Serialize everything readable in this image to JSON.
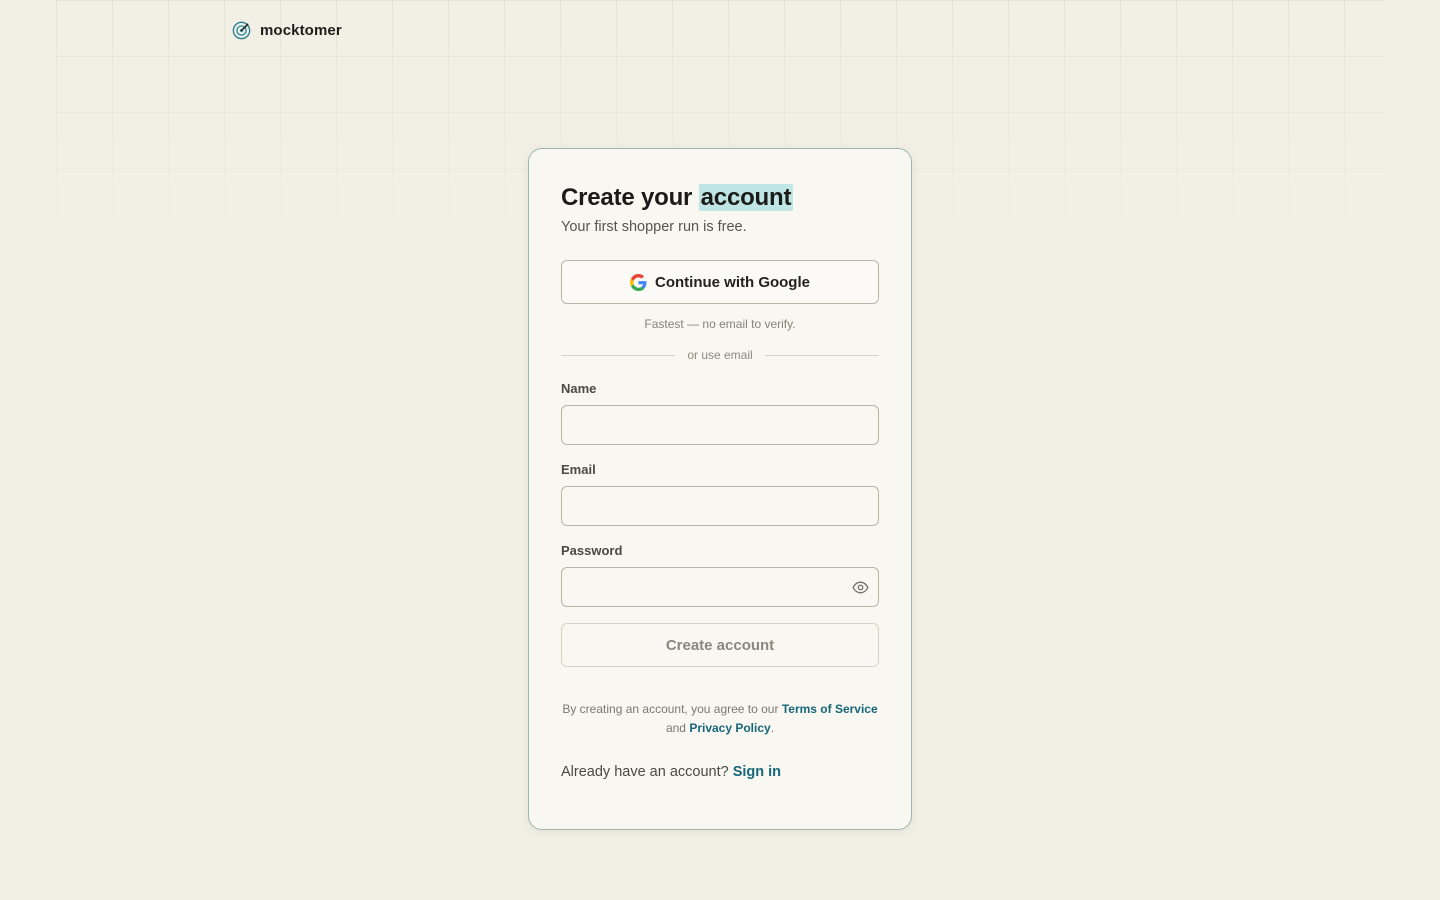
{
  "brand": {
    "name": "mocktomer",
    "logo_icon": "target-check-icon",
    "accent": "#2f7d88"
  },
  "signup": {
    "title_prefix": "Create your",
    "title_highlight": "account",
    "subtitle": "Your first shopper run is free.",
    "google_button_label": "Continue with Google",
    "google_hint": "Fastest — no email to verify.",
    "divider_text": "or use email",
    "fields": {
      "name": {
        "label": "Name",
        "value": "",
        "placeholder": ""
      },
      "email": {
        "label": "Email",
        "value": "",
        "placeholder": ""
      },
      "password": {
        "label": "Password",
        "value": "",
        "placeholder": "",
        "toggle_icon": "eye-icon"
      }
    },
    "submit_label": "Create account",
    "legal": {
      "prefix": "By creating an account, you agree to our",
      "terms_label": "Terms of Service",
      "and": "and",
      "privacy_label": "Privacy Policy",
      "suffix": "."
    },
    "signin_prompt": "Already have an account?",
    "signin_link": "Sign in"
  },
  "colors": {
    "background": "#f2efe5",
    "card": "#f9f7f1",
    "highlight": "#bfe6e4",
    "link": "#17667a"
  }
}
